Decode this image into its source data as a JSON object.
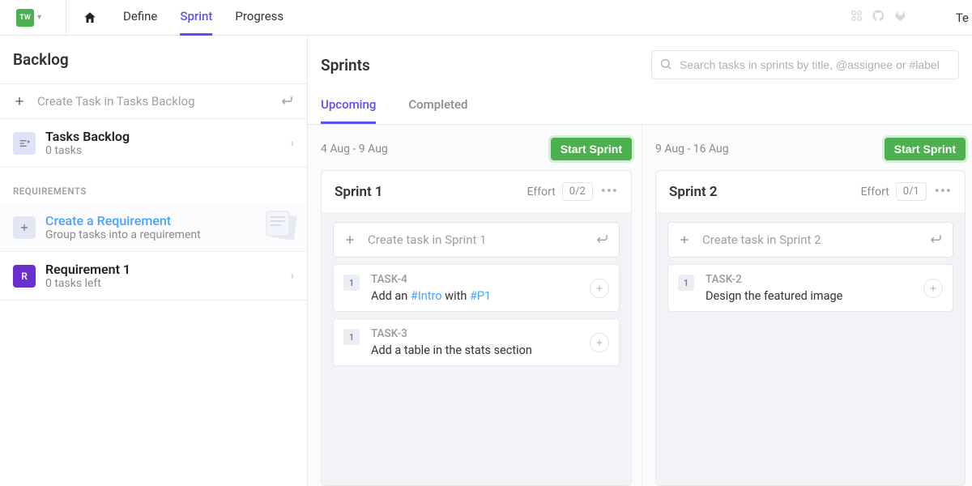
{
  "topbar": {
    "workspace_badge": "TW",
    "nav": {
      "define": "Define",
      "sprint": "Sprint",
      "progress": "Progress"
    },
    "right_link": "Te"
  },
  "sidebar": {
    "title": "Backlog",
    "create_placeholder": "Create Task in Tasks Backlog",
    "tasks_backlog": {
      "title": "Tasks Backlog",
      "subtitle": "0 tasks"
    },
    "requirements_label": "REQUIREMENTS",
    "create_requirement": {
      "title": "Create a Requirement",
      "subtitle": "Group tasks into a requirement"
    },
    "requirement1": {
      "badge": "R",
      "title": "Requirement 1",
      "subtitle": "0 tasks left"
    }
  },
  "main": {
    "title": "Sprints",
    "search_placeholder": "Search tasks in sprints by title, @assignee or #label",
    "tabs": {
      "upcoming": "Upcoming",
      "completed": "Completed"
    }
  },
  "sprints": {
    "start_label": "Start Sprint",
    "effort_label": "Effort",
    "s1": {
      "dates": "4 Aug - 9 Aug",
      "name": "Sprint 1",
      "effort": "0/2",
      "create_placeholder": "Create task in Sprint 1",
      "tasks": {
        "t0": {
          "num": "1",
          "code": "TASK-4",
          "prefix": "Add an ",
          "tag1": "#Intro",
          "mid": " with ",
          "tag2": "#P1"
        },
        "t1": {
          "num": "1",
          "code": "TASK-3",
          "title": "Add a table in the stats section"
        }
      }
    },
    "s2": {
      "dates": "9 Aug - 16 Aug",
      "name": "Sprint 2",
      "effort": "0/1",
      "create_placeholder": "Create task in Sprint 2",
      "tasks": {
        "t0": {
          "num": "1",
          "code": "TASK-2",
          "title": "Design the featured image"
        }
      }
    }
  }
}
